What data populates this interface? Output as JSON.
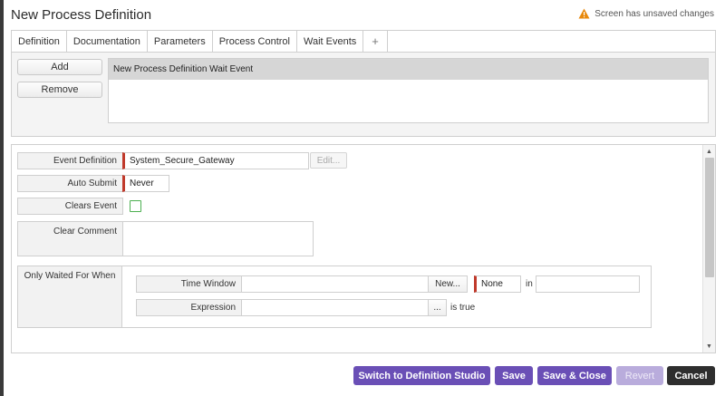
{
  "window": {
    "title": "New Process Definition",
    "unsaved_text": "Screen has unsaved changes"
  },
  "tabs": [
    {
      "label": "Definition"
    },
    {
      "label": "Documentation"
    },
    {
      "label": "Parameters"
    },
    {
      "label": "Process Control"
    },
    {
      "label": "Wait Events"
    },
    {
      "label": "+"
    }
  ],
  "wait_events": {
    "add_label": "Add",
    "remove_label": "Remove",
    "items": [
      {
        "label": "New Process Definition Wait Event"
      }
    ]
  },
  "form": {
    "event_definition": {
      "label": "Event Definition",
      "value": "System_Secure_Gateway",
      "edit_label": "Edit..."
    },
    "auto_submit": {
      "label": "Auto Submit",
      "value": "Never"
    },
    "clears_event": {
      "label": "Clears Event",
      "checked": false
    },
    "clear_comment": {
      "label": "Clear Comment",
      "value": ""
    },
    "only_waited_for_when": {
      "label": "Only Waited For When",
      "time_window": {
        "label": "Time Window",
        "value": "",
        "new_label": "New...",
        "none_value": "None",
        "in_label": "in",
        "in_value": ""
      },
      "expression": {
        "label": "Expression",
        "value": "",
        "ellipsis_label": "...",
        "suffix": "is true"
      }
    }
  },
  "footer": {
    "switch_label": "Switch to Definition Studio",
    "save_label": "Save",
    "save_close_label": "Save & Close",
    "revert_label": "Revert",
    "cancel_label": "Cancel"
  },
  "colors": {
    "accent_purple": "#6a4fb6",
    "required_red": "#c0392b",
    "checkbox_green": "#4caf50",
    "warning_orange": "#e8890c"
  }
}
